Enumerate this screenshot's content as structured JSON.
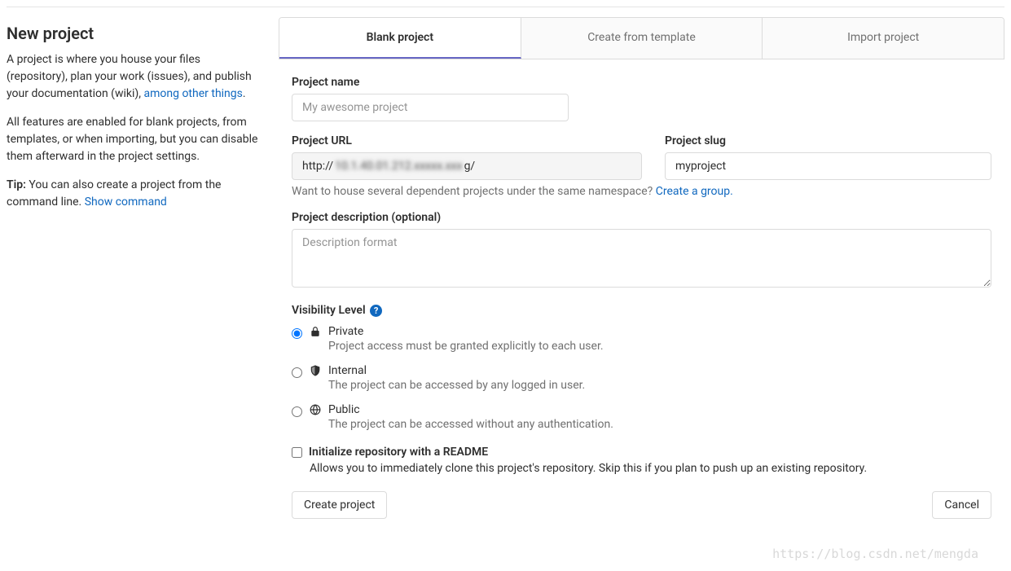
{
  "sidebar": {
    "title": "New project",
    "desc1_part1": "A project is where you house your files (repository), plan your work (issues), and publish your documentation (wiki), ",
    "desc1_link": "among other things",
    "desc1_part2": ".",
    "desc2": "All features are enabled for blank projects, from templates, or when importing, but you can disable them afterward in the project settings.",
    "tip_label": "Tip:",
    "tip_text": " You can also create a project from the command line. ",
    "tip_link": "Show command"
  },
  "tabs": {
    "blank": "Blank project",
    "template": "Create from template",
    "import": "Import project"
  },
  "form": {
    "project_name_label": "Project name",
    "project_name_placeholder": "My awesome project",
    "project_url_label": "Project URL",
    "project_url_value": "http://",
    "project_url_suffix": "g/",
    "project_slug_label": "Project slug",
    "project_slug_value": "myproject",
    "namespace_hint": "Want to house several dependent projects under the same namespace? ",
    "namespace_link": "Create a group.",
    "description_label": "Project description (optional)",
    "description_placeholder": "Description format",
    "visibility_label": "Visibility Level",
    "visibility": {
      "private": {
        "title": "Private",
        "desc": "Project access must be granted explicitly to each user."
      },
      "internal": {
        "title": "Internal",
        "desc": "The project can be accessed by any logged in user."
      },
      "public": {
        "title": "Public",
        "desc": "The project can be accessed without any authentication."
      }
    },
    "readme_label": "Initialize repository with a README",
    "readme_desc": "Allows you to immediately clone this project's repository. Skip this if you plan to push up an existing repository.",
    "create_button": "Create project",
    "cancel_button": "Cancel"
  },
  "watermark": "https://blog.csdn.net/mengda"
}
